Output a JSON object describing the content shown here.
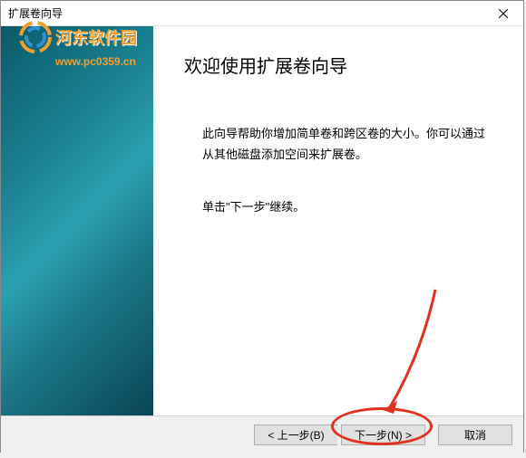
{
  "titlebar": {
    "title": "扩展卷向导"
  },
  "watermark": {
    "brand": "河东软件园",
    "url": "www.pc0359.cn"
  },
  "main": {
    "heading": "欢迎使用扩展卷向导",
    "description": "此向导帮助你增加简单卷和跨区卷的大小。你可以通过从其他磁盘添加空间来扩展卷。",
    "instruction": "单击\"下一步\"继续。"
  },
  "footer": {
    "back": "< 上一步(B)",
    "next": "下一步(N) >",
    "cancel": "取消"
  }
}
